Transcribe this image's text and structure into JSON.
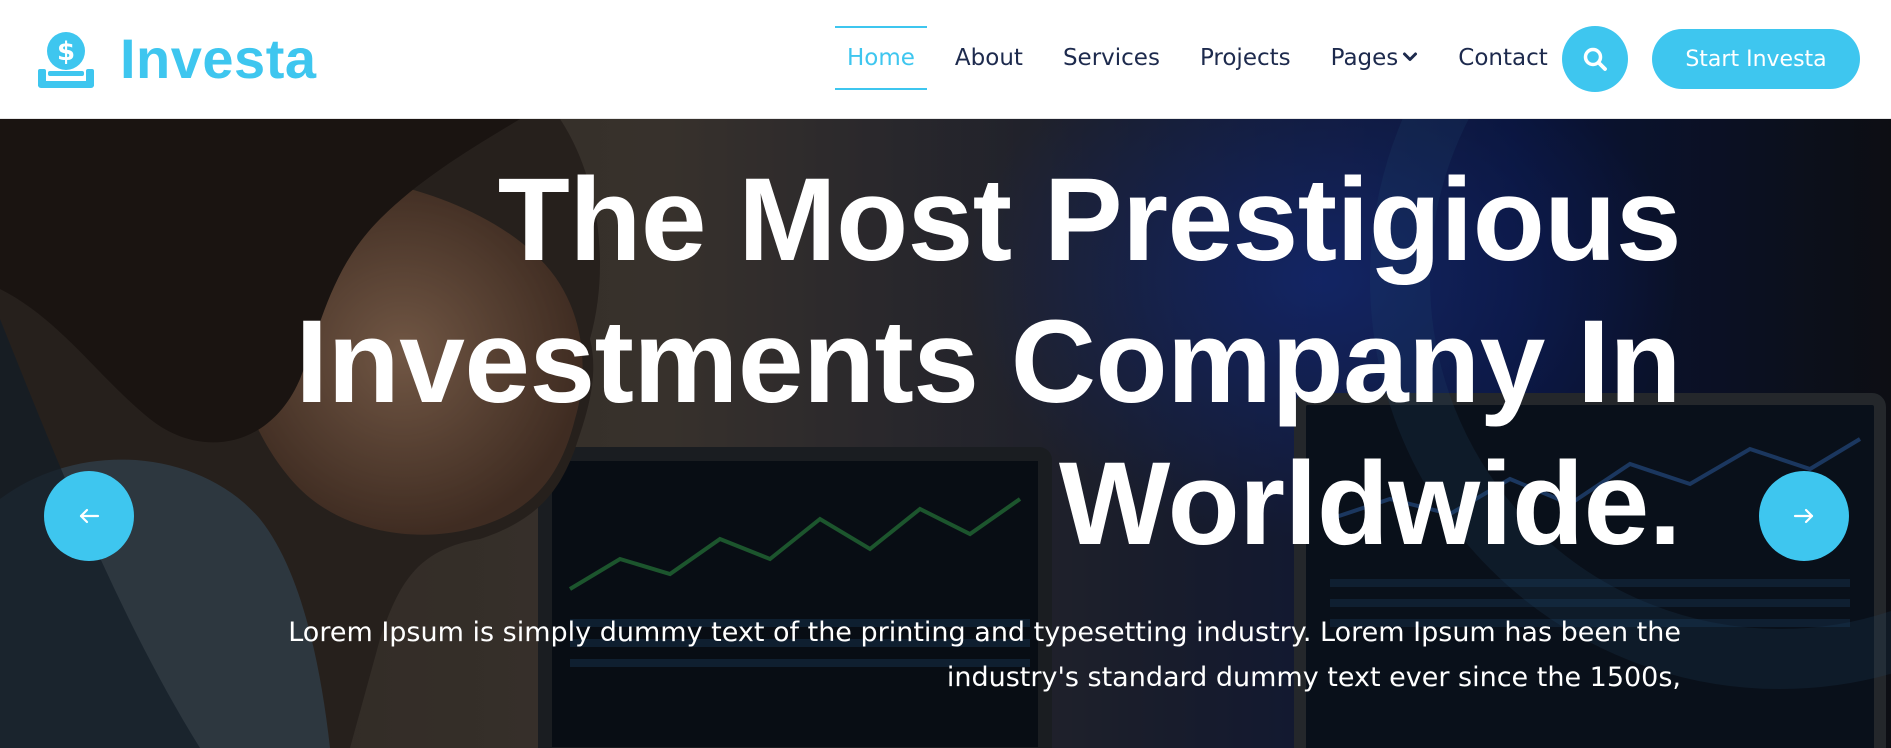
{
  "header": {
    "brand_name": "Investa",
    "brand_icon": "money-hand-icon",
    "nav": {
      "home": "Home",
      "about": "About",
      "services": "Services",
      "projects": "Projects",
      "pages": "Pages",
      "contact": "Contact"
    },
    "active_nav": "Home",
    "search_icon": "search-icon",
    "cta_label": "Start Investa"
  },
  "hero": {
    "title_line1": "The Most Prestigious",
    "title_line2": "Investments Company In",
    "title_line3": "Worldwide.",
    "description": "Lorem Ipsum is simply dummy text of the printing and typesetting industry. Lorem Ipsum has been the industry's standard dummy text ever since the 1500s,",
    "prev_icon": "arrow-left-icon",
    "next_icon": "arrow-right-icon"
  },
  "colors": {
    "accent": "#3ec6ef",
    "nav_text": "#1d2a4d",
    "hero_text": "#ffffff"
  }
}
